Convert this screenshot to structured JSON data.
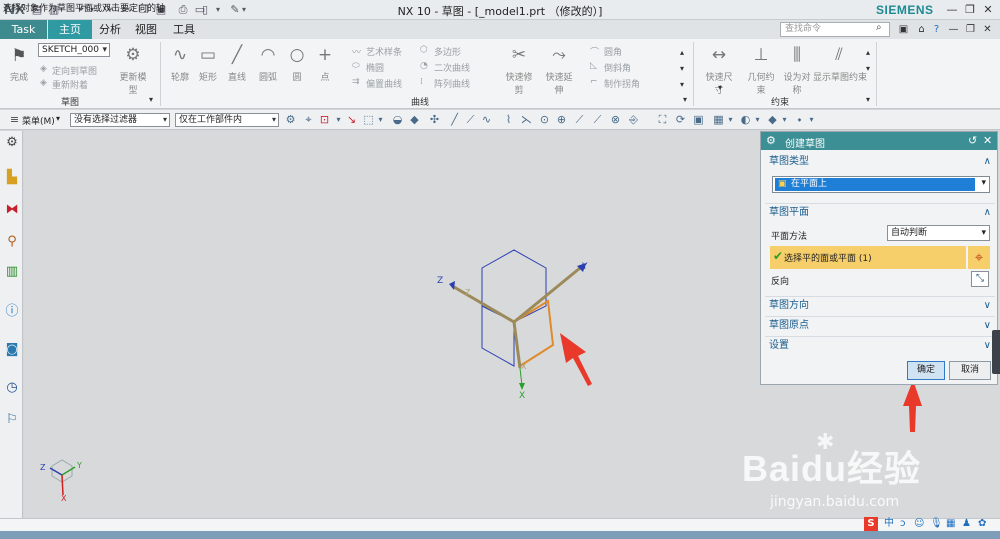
{
  "titlebar": {
    "logo": "NX",
    "title": "NX 10 - 草图 - [_model1.prt （修改的）]",
    "brand": "SIEMENS"
  },
  "tabs": {
    "task": "Task",
    "items": [
      "主页",
      "分析",
      "视图",
      "工具"
    ]
  },
  "search": {
    "placeholder": "查找命令"
  },
  "ribbon": {
    "sketch_group_title": "草图",
    "curve_group_title": "曲线",
    "constraint_group_title": "约束",
    "sketch_name": "SKETCH_000",
    "finish_label": "完成",
    "orient_view_label": "定向到草图",
    "reattach_label": "重新附着",
    "update_model_label": "更新模型",
    "profile_label": "轮廓",
    "rectangle_label": "矩形",
    "line_label": "直线",
    "arc_label": "圆弧",
    "circle_label": "圆",
    "point_label": "点",
    "studio_spline_label": "艺术样条",
    "ellipse_label": "椭圆",
    "offset_curve_label": "偏置曲线",
    "polygon_label": "多边形",
    "conic_label": "二次曲线",
    "pattern_curve_label": "阵列曲线",
    "quick_trim_label": "快速修剪",
    "quick_extend_label": "快速延伸",
    "fillet_label": "圆角",
    "chamfer_label": "倒斜角",
    "make_corner_label": "制作拐角",
    "rapid_dim_label": "快速尺寸",
    "geom_constraint_label": "几何约束",
    "make_symmetric_label": "设为对称",
    "show_constraints_label": "显示草图约束"
  },
  "selection_bar": {
    "menu_label": "菜单(M)",
    "filter_value": "没有选择过滤器",
    "scope_value": "仅在工作部件内"
  },
  "triad": {
    "x_label": "X",
    "y_label": "Y",
    "z_label": "Z",
    "x2_label": "X",
    "z2_label": "Z"
  },
  "mini_triad": {
    "x": "X",
    "y": "Y",
    "z": "Z"
  },
  "dialog": {
    "title": "创建草图",
    "type_section": "草图类型",
    "type_value": "在平面上",
    "plane_section": "草图平面",
    "plane_method_label": "平面方法",
    "plane_method_value": "自动判断",
    "select_label": "选择平的面或平面 (1)",
    "reverse_label": "反向",
    "orientation_section": "草图方向",
    "origin_section": "草图原点",
    "settings_section": "设置",
    "ok_label": "确定",
    "cancel_label": "取消"
  },
  "status": {
    "text": "选择对象作为草图平面或双击要定向的轴"
  },
  "ime": {
    "lang": "中",
    "punct": "ɔ"
  },
  "watermark": {
    "brand": "Baidu经验",
    "url": "jingyan.baidu.com"
  },
  "colors": {
    "accent": "#2f9aa2",
    "dialog_header": "#3b8f95",
    "highlight_row": "#f6ce6a",
    "arrow_red": "#e8392a",
    "axis_blue": "#2a3fb0",
    "axis_orange": "#e08a2a",
    "axis_green": "#2aa02a"
  }
}
